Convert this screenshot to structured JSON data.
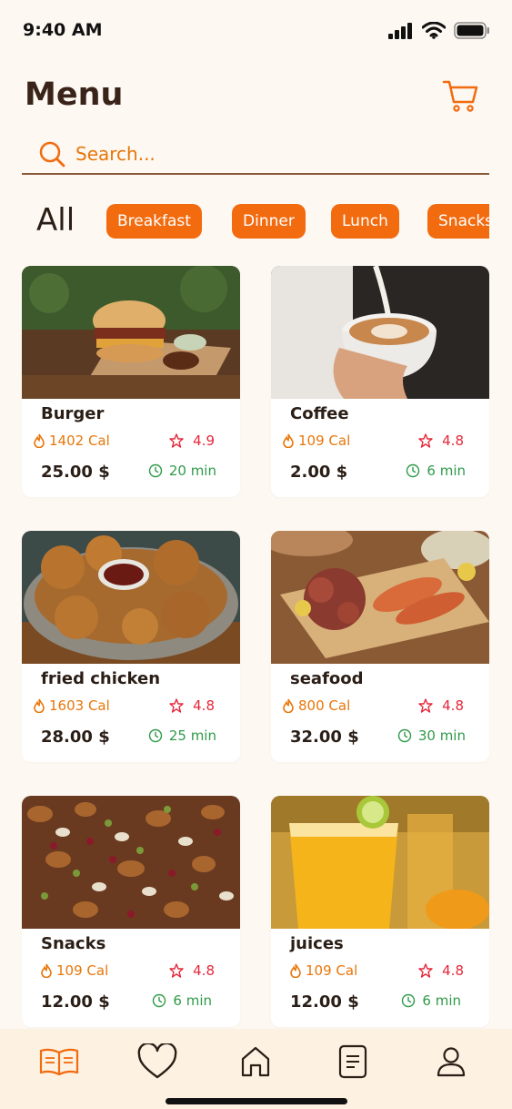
{
  "status": {
    "time": "9:40 AM"
  },
  "header": {
    "title": "Menu",
    "cart_icon": "cart-icon"
  },
  "search": {
    "placeholder": "Search..."
  },
  "categories": {
    "all": "All",
    "chips": [
      "Breakfast",
      "Dinner",
      "Lunch",
      "Snacks"
    ]
  },
  "items": [
    {
      "name": "Burger",
      "calories": "1402 Cal",
      "rating": "4.9",
      "price": "25.00 $",
      "time": "20 min"
    },
    {
      "name": "Coffee",
      "calories": "109 Cal",
      "rating": "4.8",
      "price": "2.00 $",
      "time": "6 min"
    },
    {
      "name": "fried chicken",
      "calories": "1603 Cal",
      "rating": "4.8",
      "price": "28.00 $",
      "time": "25 min"
    },
    {
      "name": "seafood",
      "calories": "800 Cal",
      "rating": "4.8",
      "price": "32.00 $",
      "time": "30 min"
    },
    {
      "name": "Snacks",
      "calories": "109 Cal",
      "rating": "4.8",
      "price": "12.00 $",
      "time": "6 min"
    },
    {
      "name": "juices",
      "calories": "109 Cal",
      "rating": "4.8",
      "price": "12.00 $",
      "time": "6 min"
    }
  ],
  "tabbar": {
    "icons": [
      "menu-book-icon",
      "heart-icon",
      "home-icon",
      "document-icon",
      "user-icon"
    ]
  },
  "colors": {
    "accent": "#f26b0f",
    "background": "#fdf8f2",
    "calories": "#e8760a",
    "rating": "#e5273a",
    "time": "#2f9a49"
  }
}
